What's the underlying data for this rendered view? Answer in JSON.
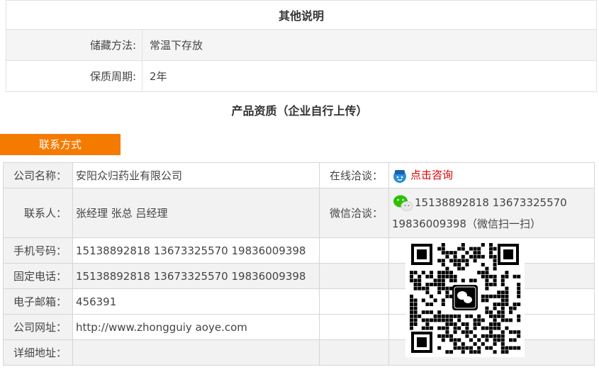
{
  "other": {
    "title": "其他说明",
    "rows": [
      {
        "label": "储藏方法:",
        "value": "常温下存放"
      },
      {
        "label": "保质周期:",
        "value": "2年"
      }
    ]
  },
  "qualification_title": "产品资质（企业自行上传）",
  "contact": {
    "tab_label": "联系方式",
    "company_label": "公司名称：",
    "company_value": "安阳众归药业有限公司",
    "online_label": "在线洽谈：",
    "online_link": "点击咨询",
    "person_label": "联系人：",
    "person_value": "张经理 张总 吕经理",
    "wechat_label": "微信洽谈：",
    "wechat_line1": "15138892818 13673325570",
    "wechat_line2": "19836009398（微信扫一扫）",
    "mobile_label": "手机号码：",
    "mobile_value": "15138892818 13673325570 19836009398",
    "phone_label": "固定电话：",
    "phone_value": "15138892818 13673325570 19836009398",
    "email_label": "电子邮箱：",
    "email_value": "456391",
    "website_label": "公司网址：",
    "website_value": "http://www.zhongguiy aoye.com",
    "address_label": "详细地址：",
    "address_value": ""
  },
  "colors": {
    "accent": "#f57a00",
    "link": "#dd0000",
    "wechat": "#2dc100"
  },
  "icons": {
    "online": "customer-service-icon",
    "wechat": "wechat-icon",
    "qr": "wechat-qr-code"
  }
}
